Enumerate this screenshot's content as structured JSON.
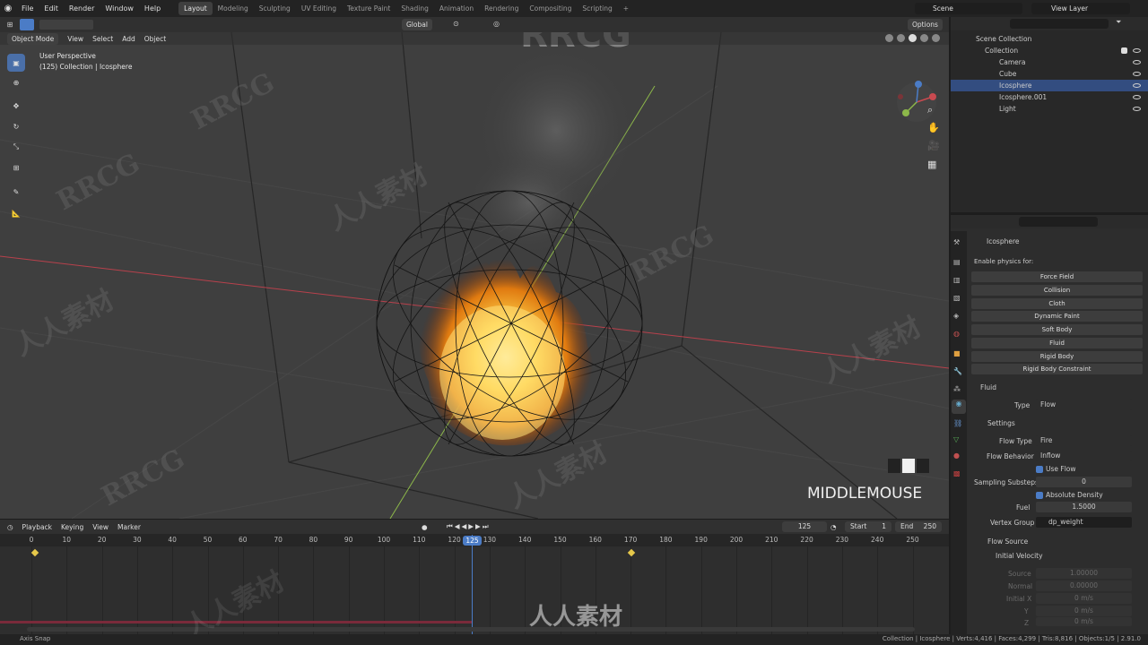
{
  "topbar": {
    "menus": [
      "File",
      "Edit",
      "Render",
      "Window",
      "Help"
    ],
    "workspaces": [
      "Layout",
      "Modeling",
      "Sculpting",
      "UV Editing",
      "Texture Paint",
      "Shading",
      "Animation",
      "Rendering",
      "Compositing",
      "Scripting"
    ],
    "active_workspace": "Layout",
    "add_workspace": "+",
    "scene": "Scene",
    "view_layer": "View Layer"
  },
  "viewport_header": {
    "mode": "Object Mode",
    "menus": [
      "View",
      "Select",
      "Add",
      "Object"
    ],
    "transform_orientation": "Global",
    "options": "Options"
  },
  "viewport": {
    "perspective": "User Perspective",
    "collection_info": "(125) Collection | Icosphere",
    "key_hint": "MIDDLEMOUSE",
    "watermark_top": "RRCG"
  },
  "outliner": {
    "items": [
      {
        "label": "Scene Collection",
        "selected": false
      },
      {
        "label": "Collection",
        "selected": false
      },
      {
        "label": "Camera",
        "selected": false
      },
      {
        "label": "Cube",
        "selected": false
      },
      {
        "label": "Icosphere",
        "selected": true
      },
      {
        "label": "Icosphere.001",
        "selected": false
      },
      {
        "label": "Light",
        "selected": false
      }
    ]
  },
  "properties": {
    "object_name": "Icosphere",
    "enable_physics_label": "Enable physics for:",
    "physics_buttons": [
      "Force Field",
      "Collision",
      "Cloth",
      "Dynamic Paint",
      "Soft Body",
      "Fluid",
      "Rigid Body",
      "Rigid Body Constraint"
    ],
    "fluid_panel": "Fluid",
    "type_label": "Type",
    "type_value": "Flow",
    "settings_panel": "Settings",
    "flow_type_label": "Flow Type",
    "flow_type_value": "Fire",
    "flow_behavior_label": "Flow Behavior",
    "flow_behavior_value": "Inflow",
    "use_flow": "Use Flow",
    "sampling_substeps_label": "Sampling Substeps",
    "sampling_substeps_value": "0",
    "absolute_density": "Absolute Density",
    "fuel_label": "Fuel",
    "fuel_value": "1.5000",
    "vertex_group_label": "Vertex Group",
    "vertex_group_value": "dp_weight",
    "flow_source_panel": "Flow Source",
    "initial_velocity_panel": "Initial Velocity",
    "source_label": "Source",
    "source_value": "1.00000",
    "normal_label": "Normal",
    "normal_value": "0.00000",
    "initial_x_label": "Initial X",
    "initial_x_value": "0 m/s",
    "y_label": "Y",
    "y_value": "0 m/s",
    "z_label": "Z",
    "z_value": "0 m/s"
  },
  "timeline": {
    "menus": [
      "Playback",
      "Keying",
      "View",
      "Marker"
    ],
    "current_frame": "125",
    "start_label": "Start",
    "start_value": "1",
    "end_label": "End",
    "end_value": "250",
    "ruler": [
      "0",
      "10",
      "20",
      "30",
      "40",
      "50",
      "60",
      "70",
      "80",
      "90",
      "100",
      "110",
      "120",
      "125",
      "130",
      "140",
      "150",
      "160",
      "170",
      "180",
      "190",
      "200",
      "210",
      "220",
      "230",
      "240",
      "250"
    ]
  },
  "status": {
    "left": "Axis Snap",
    "right": "Collection | Icosphere | Verts:4,416 | Faces:4,299 | Tris:8,816 | Objects:1/5 | 2.91.0"
  },
  "watermarks": {
    "latin": "RRCG",
    "cjk": "人人素材"
  },
  "colors": {
    "accent": "#4b7cc6",
    "selection": "#334d80",
    "viewport_bg": "#3f3f3f",
    "fire_core": "#ffe27a",
    "fire_edge": "#e07a10",
    "x_axis": "#c0404a",
    "y_axis": "#8db84a"
  }
}
